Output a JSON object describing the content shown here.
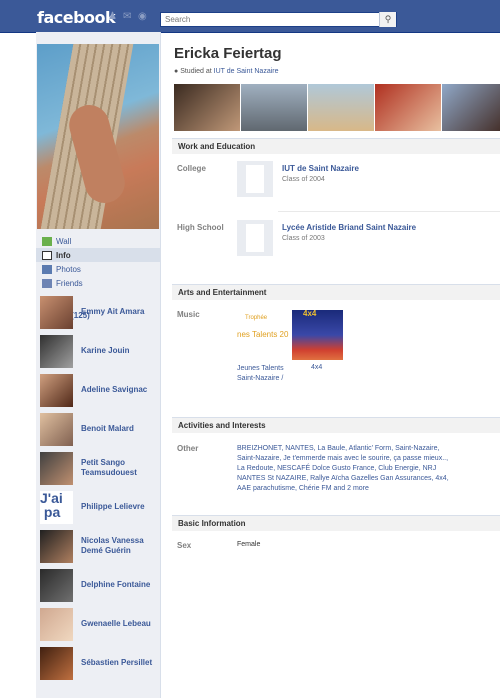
{
  "header": {
    "logo": "facebook",
    "search_placeholder": "Search"
  },
  "profile": {
    "name": "Ericka Feiertag",
    "studied_prefix": "Studied at ",
    "studied_link": "IUT de Saint Nazaire"
  },
  "nav": [
    {
      "label": "Wall"
    },
    {
      "label": "Info"
    },
    {
      "label": "Photos"
    },
    {
      "label": "Friends"
    }
  ],
  "friends": {
    "heading": "Friends (125)",
    "list": [
      "Emmy Ait Amara",
      "Karine Jouin",
      "Adeline Savignac",
      "Benoit Malard",
      "Petit Sango Teamsudouest",
      "Philippe Lelievre",
      "Nicolas Vanessa Demé Guérin",
      "Delphine Fontaine",
      "Gwenaelle Lebeau",
      "Sébastien Persillet"
    ]
  },
  "work": {
    "heading": "Work and Education",
    "college_label": "College",
    "college_name": "IUT de Saint Nazaire",
    "college_sub": "Class of 2004",
    "hs_label": "High School",
    "hs_name": "Lycée Aristide Briand Saint Nazaire",
    "hs_sub": "Class of 2003"
  },
  "arts": {
    "heading": "Arts and Entertainment",
    "music_label": "Music",
    "item1_caption": "Jeunes Talents Saint-Nazaire /",
    "item1_img_top": "Trophée",
    "item1_img_text": "nes Talents 20",
    "item2_caption": "4x4",
    "item2_img_text": "4x4"
  },
  "activities": {
    "heading": "Activities and Interests",
    "other_label": "Other",
    "text": "BREIZHONET, NANTES, La Baule, Atlantic' Form, Saint-Nazaire, Saint-Nazaire, Je t'emmerde mais avec le sourire, ça passe mieux.., La Redoute, NESCAFÉ Dolce Gusto France, Club Energie, NRJ NANTES St NAZAIRE, Rallye Aïcha Gazelles Gan Assurances, 4x4, AAE parachutisme, Chérie FM and 2 more"
  },
  "basic": {
    "heading": "Basic Information",
    "sex_label": "Sex",
    "sex_value": "Female"
  }
}
